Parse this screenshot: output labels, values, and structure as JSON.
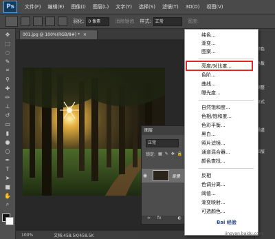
{
  "app": {
    "logo": "Ps"
  },
  "menu": [
    "文件(F)",
    "编辑(E)",
    "图像(I)",
    "图层(L)",
    "文字(Y)",
    "选择(S)",
    "滤镜(T)",
    "3D(D)",
    "视图(V)"
  ],
  "options": {
    "feather_label": "羽化:",
    "feather_value": "0 像素",
    "antialias_label": "消除锯齿",
    "style_label": "样式:",
    "style_value": "正常",
    "width_label": "宽度:"
  },
  "document": {
    "tab_title": "001.jpg @ 100%(RGB/8#) *",
    "close_glyph": "×"
  },
  "status": {
    "zoom": "100%",
    "doc_info": "文档:458.5K/458.5K"
  },
  "right_panel": [
    "颜色",
    "色板",
    "调整",
    "样式",
    "通道",
    "图层"
  ],
  "layers_panel": {
    "tab": "图层",
    "blend_mode": "正常",
    "lock_label": "锁定:",
    "layer_name": "背景",
    "footer": "fx"
  },
  "dropdown_items": [
    "纯色...",
    "渐变...",
    "图案...",
    "亮度/对比度...",
    "色阶...",
    "曲线...",
    "曝光度...",
    "自然饱和度...",
    "色相/饱和度...",
    "色彩平衡...",
    "黑白...",
    "照片滤镜...",
    "通道混合器...",
    "颜色查找...",
    "反相",
    "色调分离...",
    "阈值...",
    "渐变映射...",
    "可选颜色..."
  ],
  "highlighted_item": "亮度/对比度...",
  "watermark": {
    "brand": "Bai 经验",
    "url": "jingyan.baidu.com"
  },
  "colors": {
    "highlight_border": "#e02828",
    "ui_dark": "#3a3a3a",
    "menu_bg": "#ffffff"
  }
}
